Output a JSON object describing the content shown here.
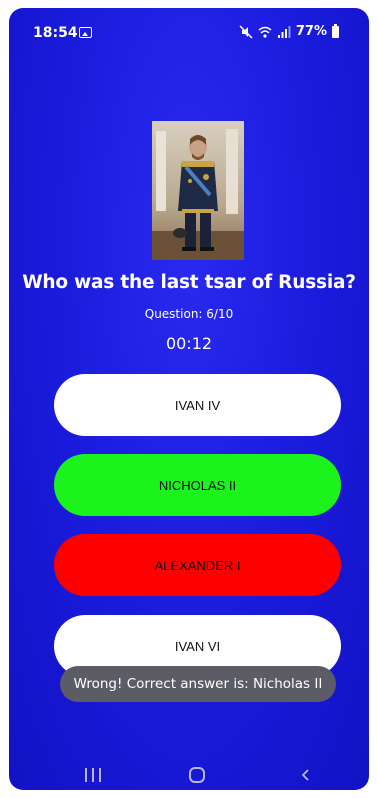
{
  "status_bar": {
    "time": "18:54",
    "battery": "77%",
    "icons": [
      "gallery-icon",
      "mute-icon",
      "wifi-icon",
      "signal-icon",
      "battery-icon"
    ]
  },
  "quiz": {
    "question": "Who was the last tsar of Russia?",
    "counter": "Question: 6/10",
    "timer": "00:12",
    "answers": [
      {
        "label": "IVAN IV",
        "state": "neutral",
        "color": "#ffffff"
      },
      {
        "label": "NICHOLAS II",
        "state": "correct",
        "color": "#1cf21c"
      },
      {
        "label": "ALEXANDER I",
        "state": "wrong",
        "color": "#ff0000"
      },
      {
        "label": "IVAN VI",
        "state": "neutral",
        "color": "#ffffff"
      }
    ]
  },
  "toast": {
    "message": "Wrong! Correct answer is: Nicholas II"
  },
  "nav": {
    "icons": [
      "recents-icon",
      "home-icon",
      "back-icon"
    ]
  },
  "colors": {
    "background": "#1a1adb",
    "correct": "#1cf21c",
    "wrong": "#ff0000",
    "toast": "#5c5c66"
  }
}
